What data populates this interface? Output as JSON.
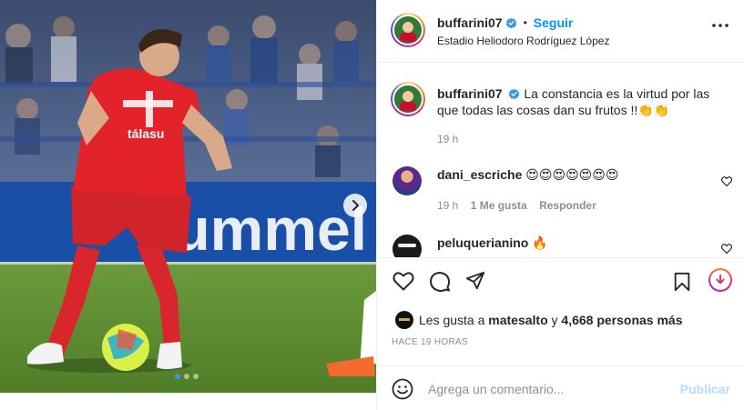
{
  "post": {
    "username": "buffarini07",
    "follow_label": "Seguir",
    "separator": "•",
    "location": "Estadio Heliodoro Rodríguez López",
    "caption": "La constancia es la virtud por las que todas las cosas dan su frutos !!👏👏",
    "caption_time": "19 h"
  },
  "photo": {
    "shirt_sponsor": "tálasu\ngroup",
    "board_text": "hummel",
    "carousel_total": 3,
    "carousel_active": 0
  },
  "comments": [
    {
      "username": "dani_escriche",
      "text": "😍😍😍😍😍😍😍",
      "time": "19 h",
      "likes": "1 Me gusta",
      "reply": "Responder"
    },
    {
      "username": "peluquerianino",
      "text": "🔥"
    }
  ],
  "likes": {
    "prefix": "Les gusta a",
    "user": "matesalto",
    "connector": "y",
    "others": "4,668 personas más"
  },
  "time_ago": "HACE 19 HORAS",
  "comment_box": {
    "placeholder": "Agrega un comentario...",
    "publish_label": "Publicar"
  },
  "icons": [
    "heart-icon",
    "comment-icon",
    "share-icon",
    "bookmark-icon",
    "more-icon",
    "emoji-icon",
    "chevron-right-icon"
  ],
  "colors": {
    "accent": "#0095f6",
    "verified": "#3897f0",
    "jersey": "#e2232a",
    "publish_disabled": "#b3dbff"
  }
}
